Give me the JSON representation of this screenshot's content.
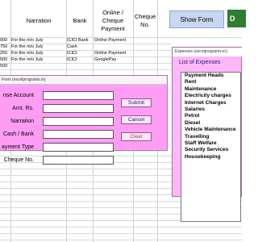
{
  "sheet": {
    "headers": {
      "narration": "Narration",
      "bank": "Bank",
      "online_cheque_payment": "Online / Cheque Payment",
      "cheque_no": "Cheque No."
    },
    "rows": [
      {
        "amount": "000",
        "narration": "For the m/o July",
        "bank": "ICICI Bank",
        "payment": "Online Payment"
      },
      {
        "amount": "750",
        "narration": "For the m/o July",
        "bank": "Cash",
        "payment": ""
      },
      {
        "amount": "250",
        "narration": "For the m/o July",
        "bank": "ICICI",
        "payment": "Online Payment"
      },
      {
        "amount": "500",
        "narration": "For the m/o July",
        "bank": "ICICI",
        "payment": "GooglePay"
      },
      {
        "amount": "500",
        "narration": "",
        "bank": "",
        "payment": ""
      }
    ],
    "show_form_label": "Show Form",
    "logo_text": "D"
  },
  "form": {
    "title": "Form (excelprograms.in)",
    "labels": {
      "expense_account": "nse Account",
      "amount": "Amt. Rs.",
      "narration": "Narration",
      "cash_bank": "Cash / Bank",
      "payment_type": "ayment Type",
      "cheque_no": "Cheque No."
    },
    "buttons": {
      "submit": "Submit",
      "cancel": "Cancel",
      "clear": "Clear"
    },
    "colors": {
      "background": "#ff9df5",
      "clear_text": "#c0392b",
      "button_text": "#1a1a8a"
    }
  },
  "expenses": {
    "title": "Expenses (excelprograms.in)",
    "heading": "List of Expenses",
    "items": [
      "Payment Heads",
      "Rent",
      "Maintenance",
      "Electricity charges",
      "Internet Charges",
      "Salaries",
      "Petrol",
      "Diesel",
      "Vehicle Maintenance",
      "Travelling",
      "Staff Welfare",
      "Security Services",
      "Housekeeping"
    ]
  }
}
